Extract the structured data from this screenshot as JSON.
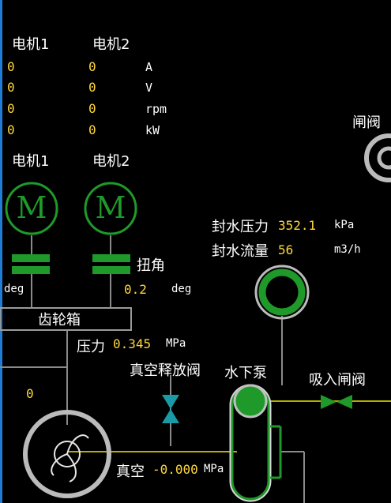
{
  "motors_table": {
    "headers": [
      "电机1",
      "电机2"
    ],
    "rows": [
      {
        "m1": "0",
        "m2": "0",
        "unit": "A"
      },
      {
        "m1": "0",
        "m2": "0",
        "unit": "V"
      },
      {
        "m1": "0",
        "m2": "0",
        "unit": "rpm"
      },
      {
        "m1": "0",
        "m2": "0",
        "unit": "kW"
      }
    ]
  },
  "motor_labels": [
    "电机1",
    "电机2"
  ],
  "motor_symbol": "M",
  "torque": {
    "label": "扭角",
    "left_unit": "deg",
    "value": "0.2",
    "unit": "deg"
  },
  "gearbox": {
    "label": "齿轮箱"
  },
  "pressure": {
    "label": "压力",
    "value": "0.345",
    "unit": "MPa"
  },
  "vacuum_valve": {
    "label": "真空释放阀"
  },
  "underwater_pump": {
    "label": "水下泵"
  },
  "suction_valve": {
    "label": "吸入闸阀"
  },
  "gate_valve_top": {
    "label": "闸阀"
  },
  "seal_water": {
    "pressure_label": "封水压力",
    "pressure_value": "352.1",
    "pressure_unit": "kPa",
    "flow_label": "封水流量",
    "flow_value": "56",
    "flow_unit": "m3/h"
  },
  "cutter_value": "0",
  "vacuum": {
    "label": "真空",
    "value": "-0.000",
    "unit": "MPa"
  },
  "colors": {
    "green": "#1f9a2a",
    "yellow_line": "#b4b000",
    "value": "#ffd83a",
    "teal_valve": "#1a9aa6"
  }
}
